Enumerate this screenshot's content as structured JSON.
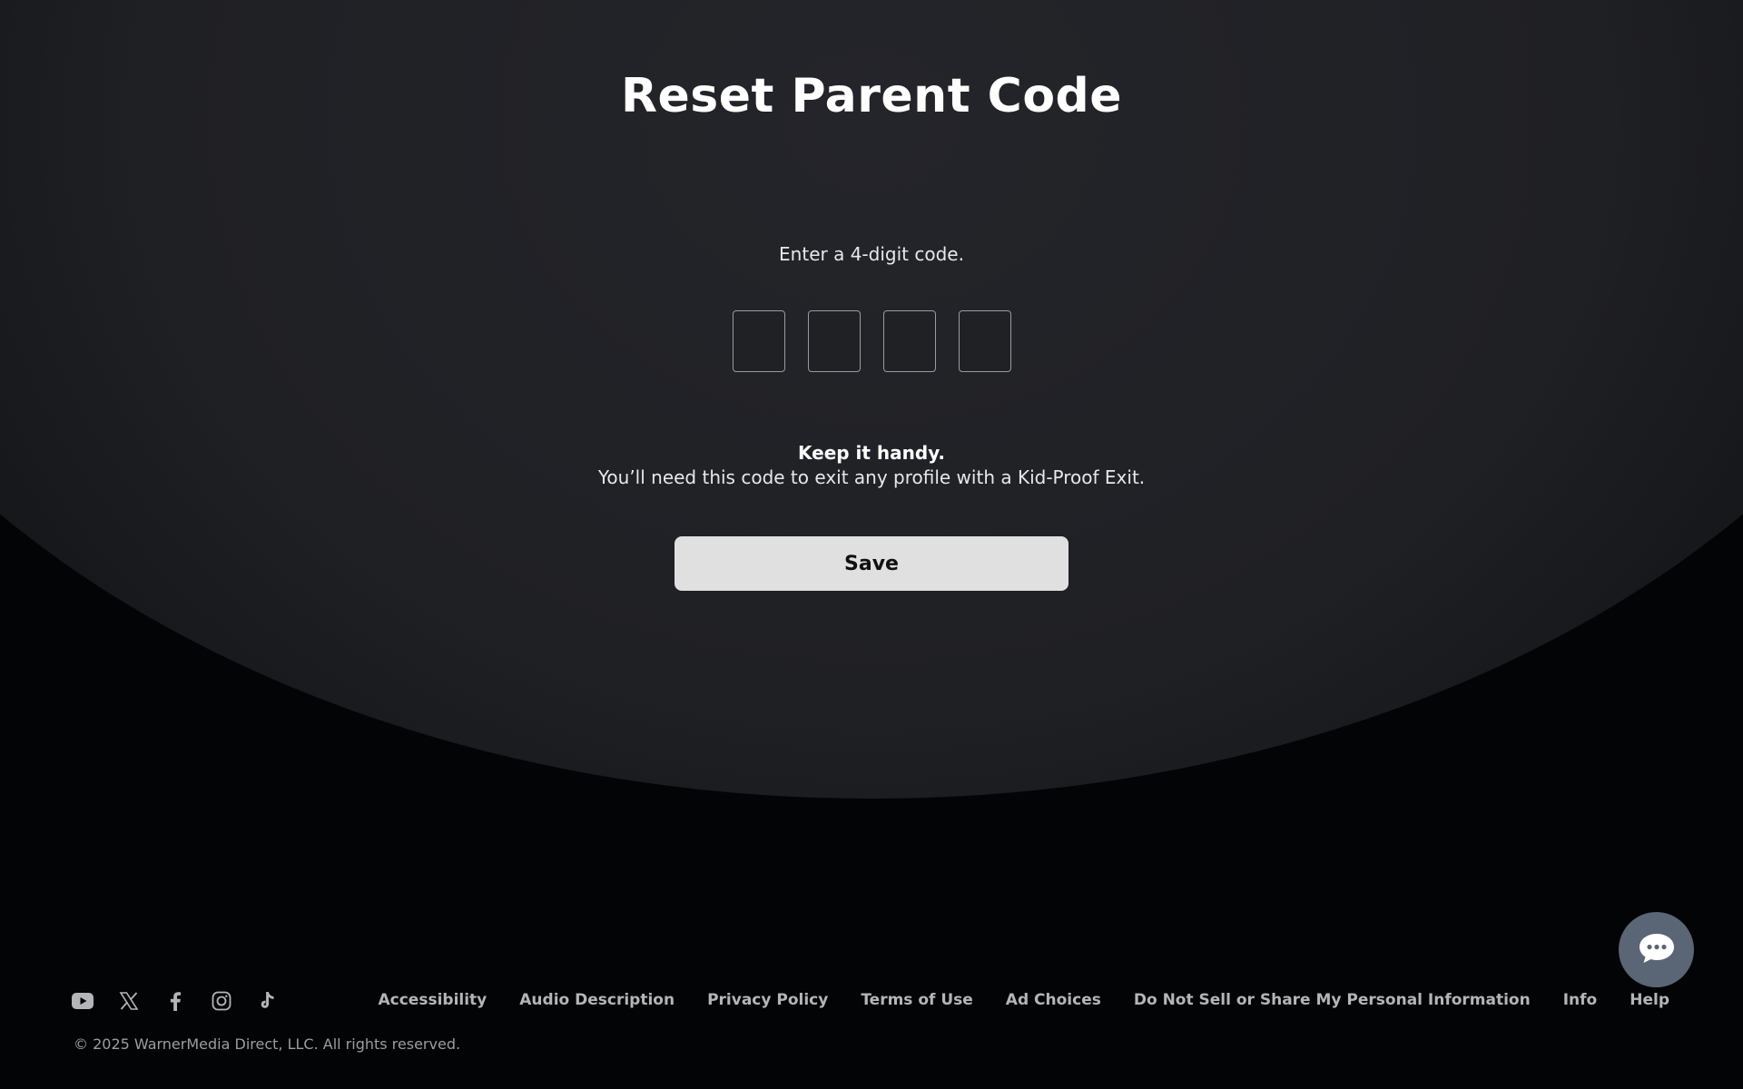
{
  "page": {
    "title": "Reset Parent Code",
    "instruction": "Enter a 4-digit code.",
    "code_inputs": [
      "",
      "",
      "",
      ""
    ],
    "note_title": "Keep it handy.",
    "note_body": "You’ll need this code to exit any profile with a Kid-Proof Exit.",
    "save_label": "Save"
  },
  "footer": {
    "social_icons": [
      "youtube-icon",
      "x-icon",
      "facebook-icon",
      "instagram-icon",
      "tiktok-icon"
    ],
    "links": [
      "Accessibility",
      "Audio Description",
      "Privacy Policy",
      "Terms of Use",
      "Ad Choices",
      "Do Not Sell or Share My Personal Information",
      "Info",
      "Help"
    ],
    "copyright": "© 2025 WarnerMedia Direct, LLC. All rights reserved."
  },
  "chat": {
    "icon": "chat-bubble-icon"
  },
  "colors": {
    "background": "#030405",
    "button": "#e0e0e0",
    "chat_button": "#5a6575",
    "footer_text": "#b4b5b9"
  }
}
